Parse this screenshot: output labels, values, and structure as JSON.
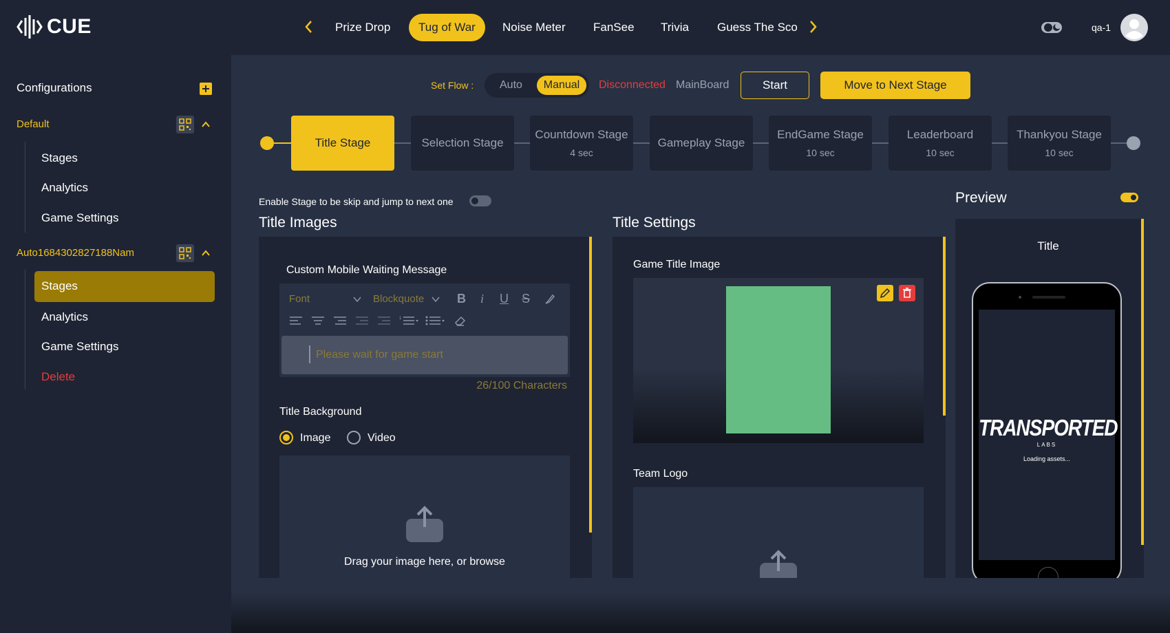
{
  "header": {
    "logo_text": "CUE",
    "tabs": [
      {
        "label": "Prize Drop"
      },
      {
        "label": "Tug of War",
        "active": true
      },
      {
        "label": "Noise Meter"
      },
      {
        "label": "FanSee"
      },
      {
        "label": "Trivia"
      },
      {
        "label": "Guess The Sco"
      }
    ],
    "user": "qa-1"
  },
  "sidebar": {
    "title": "Configurations",
    "groups": [
      {
        "name": "Default",
        "items": [
          "Stages",
          "Analytics",
          "Game Settings"
        ]
      },
      {
        "name": "Auto1684302827188Nam",
        "items": [
          "Stages",
          "Analytics",
          "Game Settings",
          "Delete"
        ],
        "active_item": "Stages"
      }
    ]
  },
  "flow": {
    "label": "Set Flow :",
    "options": [
      "Auto",
      "Manual"
    ],
    "selected": "Manual",
    "status": "Disconnected",
    "board": "MainBoard",
    "start_label": "Start",
    "next_label": "Move to Next Stage"
  },
  "stages": [
    {
      "name": "Title Stage",
      "sec": "",
      "active": true
    },
    {
      "name": "Selection Stage",
      "sec": ""
    },
    {
      "name": "Countdown Stage",
      "sec": "4 sec"
    },
    {
      "name": "Gameplay Stage",
      "sec": ""
    },
    {
      "name": "EndGame Stage",
      "sec": "10 sec"
    },
    {
      "name": "Leaderboard",
      "sec": "10 sec"
    },
    {
      "name": "Thankyou Stage",
      "sec": "10 sec"
    }
  ],
  "skip_toggle_label": "Enable Stage to be skip and jump to next one",
  "title_images": {
    "heading": "Title Images",
    "waiting_label": "Custom Mobile Waiting Message",
    "editor": {
      "font_placeholder": "Font",
      "format_label": "Blockquote",
      "placeholder": "Please wait for game start",
      "char_count": "26/100 Characters"
    },
    "background_label": "Title Background",
    "radio_image": "Image",
    "radio_video": "Video",
    "radio_selected": "Image",
    "upload_text": "Drag your image here, or browse"
  },
  "title_settings": {
    "heading": "Title Settings",
    "game_title_image_label": "Game Title Image",
    "team_logo_label": "Team Logo",
    "image_color": "#66bd83"
  },
  "preview": {
    "heading": "Preview",
    "screen_title": "Title",
    "brand_main": "TRANSPORTED",
    "brand_sub": "LABS",
    "loading": "Loading assets..."
  },
  "colors": {
    "accent": "#f2c21c",
    "danger": "#e63c3c",
    "bg": "#1e2433",
    "main": "#283143"
  }
}
